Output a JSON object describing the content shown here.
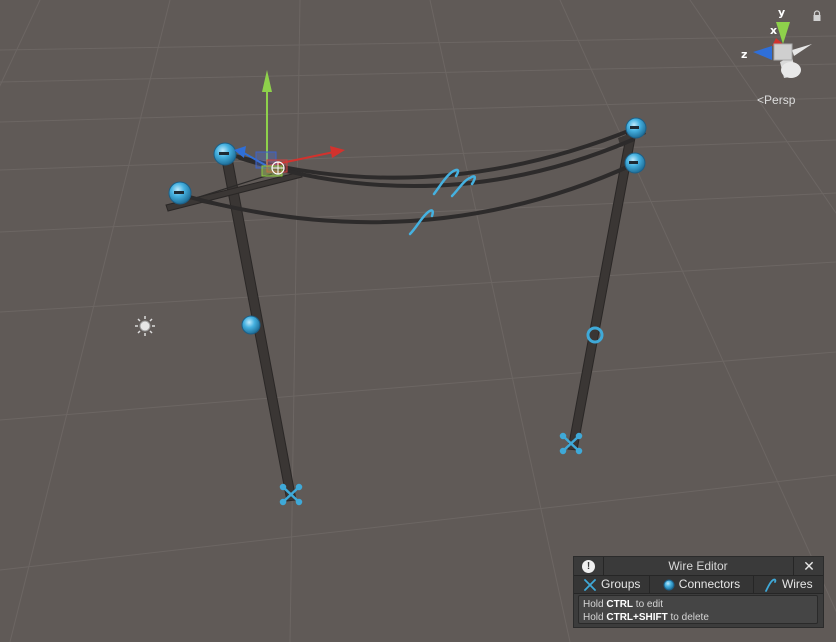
{
  "viewport": {
    "camera_label": "Persp",
    "camera_chevron": "<",
    "axis_labels": {
      "y": "y",
      "x": "x",
      "z": "z"
    },
    "icons": [
      "lock-icon",
      "sun-light-icon",
      "move-gizmo-icon",
      "connector-icon",
      "wire-icon",
      "group-icon"
    ]
  },
  "wire_editor": {
    "info_glyph": "!",
    "title": "Wire Editor",
    "close_glyph": "✕",
    "tabs": [
      {
        "label": "Groups",
        "icon": "group-icon"
      },
      {
        "label": "Connectors",
        "icon": "connector-icon"
      },
      {
        "label": "Wires",
        "icon": "wire-icon"
      }
    ],
    "help": {
      "line1_pre": "Hold ",
      "line1_key": "CTRL",
      "line1_post": " to edit",
      "line2_pre": "Hold ",
      "line2_key": "CTRL+SHIFT",
      "line2_post": " to delete"
    }
  },
  "colors": {
    "background": "#605a57",
    "grid": "#6e6865",
    "pole": "#3a3634",
    "wire": "#2d2b2b",
    "connector": "#3fa9d8",
    "axis_x": "#d2322d",
    "axis_y": "#8ed14b",
    "axis_z": "#2f6fd8"
  }
}
